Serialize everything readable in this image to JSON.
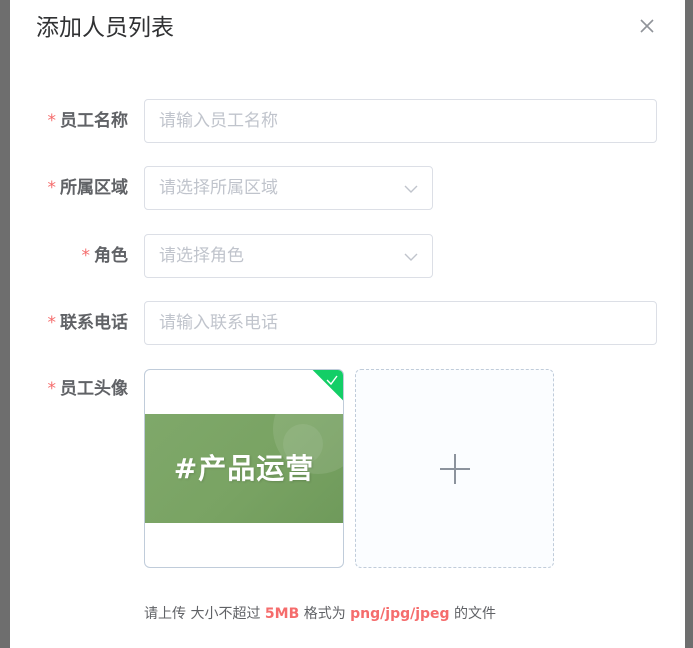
{
  "dialog": {
    "title": "添加人员列表",
    "close_icon": "close-icon"
  },
  "form": {
    "required_mark": "*",
    "employee_name": {
      "label": "员工名称",
      "placeholder": "请输入员工名称",
      "value": ""
    },
    "region": {
      "label": "所属区域",
      "placeholder": "请选择所属区域",
      "value": ""
    },
    "role": {
      "label": "角色",
      "placeholder": "请选择角色",
      "value": ""
    },
    "phone": {
      "label": "联系电话",
      "placeholder": "请输入联系电话",
      "value": ""
    },
    "avatar": {
      "label": "员工头像",
      "thumbnail_text": "#产品运营",
      "status_icon": "check-icon",
      "add_icon": "plus-icon"
    }
  },
  "hint": {
    "prefix": "请上传 大小不超过",
    "size": "5MB",
    "mid": "格式为",
    "formats": "png/jpg/jpeg",
    "suffix": "的文件"
  },
  "colors": {
    "required": "#f56c6c",
    "success": "#13ce66",
    "thumbnail_bg": "#79a363"
  }
}
